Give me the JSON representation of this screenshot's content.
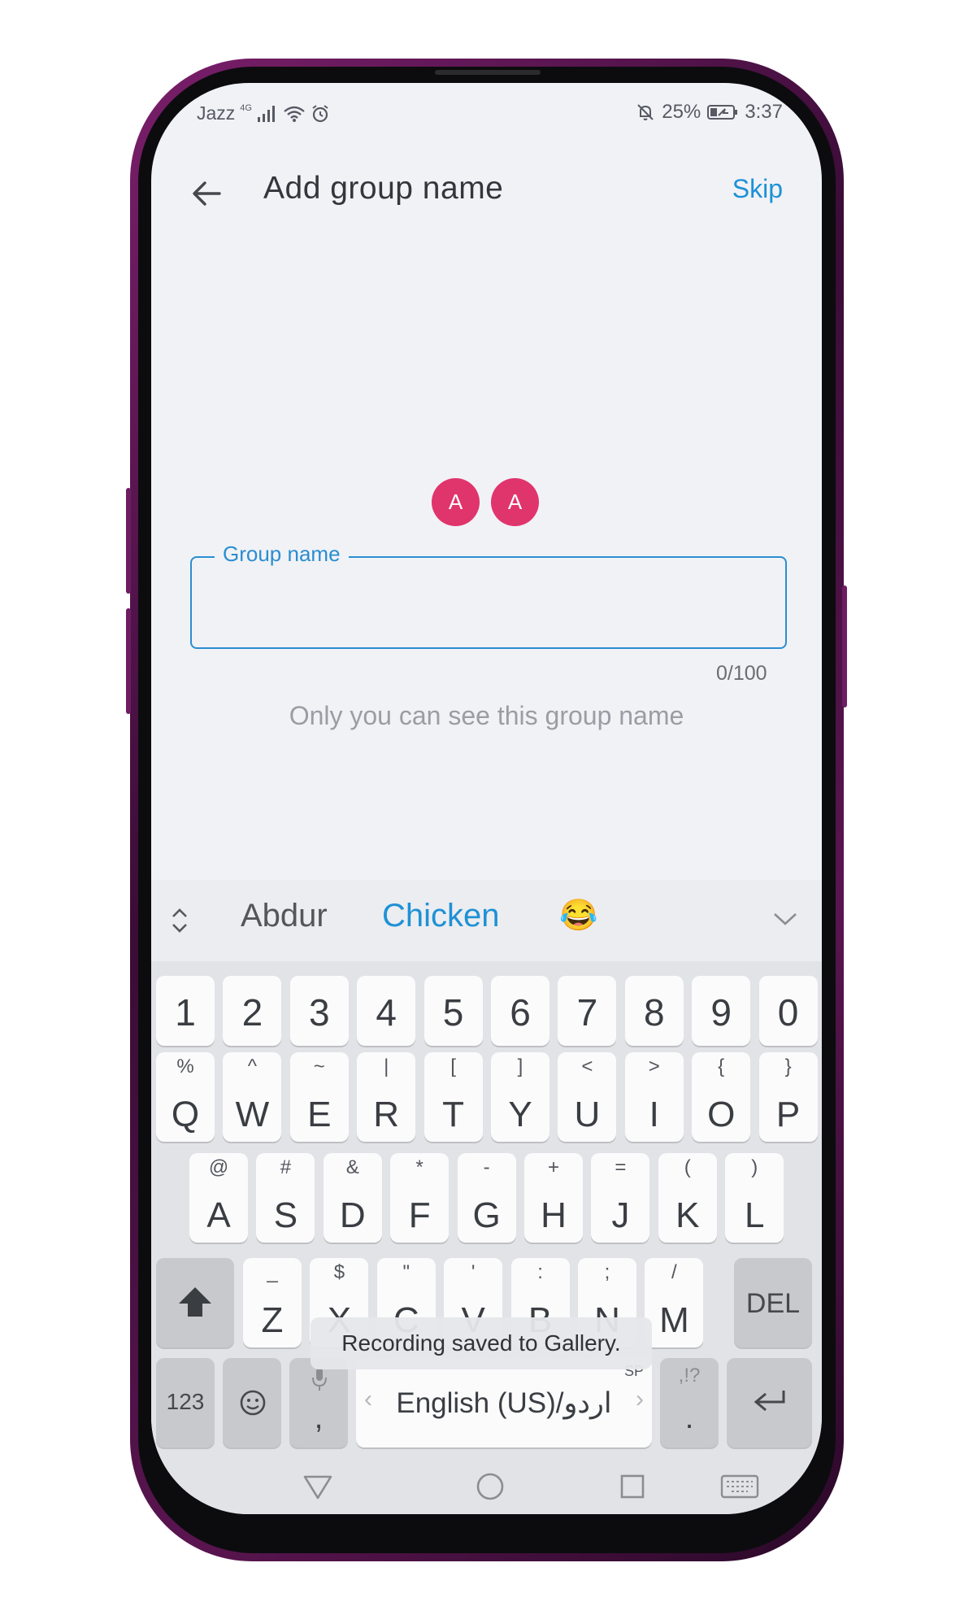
{
  "status": {
    "carrier": "Jazz",
    "network": "4G",
    "battery": "25%",
    "time": "3:37"
  },
  "header": {
    "title": "Add group name",
    "skip_label": "Skip"
  },
  "avatars": [
    "A",
    "A"
  ],
  "group_field": {
    "label": "Group name",
    "value": "",
    "counter": "0/100"
  },
  "hint": "Only you can see this group name",
  "keyboard": {
    "suggestions": [
      "Abdur",
      "Chicken",
      "😂"
    ],
    "number_row": [
      "1",
      "2",
      "3",
      "4",
      "5",
      "6",
      "7",
      "8",
      "9",
      "0"
    ],
    "row1": [
      {
        "sub": "%",
        "main": "Q"
      },
      {
        "sub": "^",
        "main": "W"
      },
      {
        "sub": "~",
        "main": "E"
      },
      {
        "sub": "|",
        "main": "R"
      },
      {
        "sub": "[",
        "main": "T"
      },
      {
        "sub": "]",
        "main": "Y"
      },
      {
        "sub": "<",
        "main": "U"
      },
      {
        "sub": ">",
        "main": "I"
      },
      {
        "sub": "{",
        "main": "O"
      },
      {
        "sub": "}",
        "main": "P"
      }
    ],
    "row2": [
      {
        "sub": "@",
        "main": "A"
      },
      {
        "sub": "#",
        "main": "S"
      },
      {
        "sub": "&",
        "main": "D"
      },
      {
        "sub": "*",
        "main": "F"
      },
      {
        "sub": "-",
        "main": "G"
      },
      {
        "sub": "+",
        "main": "H"
      },
      {
        "sub": "=",
        "main": "J"
      },
      {
        "sub": "(",
        "main": "K"
      },
      {
        "sub": ")",
        "main": "L"
      }
    ],
    "row3": [
      {
        "sub": "_",
        "main": "Z"
      },
      {
        "sub": "$",
        "main": "X"
      },
      {
        "sub": "\"",
        "main": "C"
      },
      {
        "sub": "'",
        "main": "V"
      },
      {
        "sub": ":",
        "main": "B"
      },
      {
        "sub": ";",
        "main": "N"
      },
      {
        "sub": "/",
        "main": "M"
      }
    ],
    "del_label": "DEL",
    "mode_label": "123",
    "comma_label": ",",
    "space_label": "English (US)/اردو",
    "space_badge": "SP",
    "period_sub": ",!?",
    "period_label": "."
  },
  "toast": "Recording saved to Gallery.",
  "colors": {
    "accent": "#1e91d6",
    "avatar": "#e0346d",
    "screen_bg": "#f1f2f6"
  }
}
